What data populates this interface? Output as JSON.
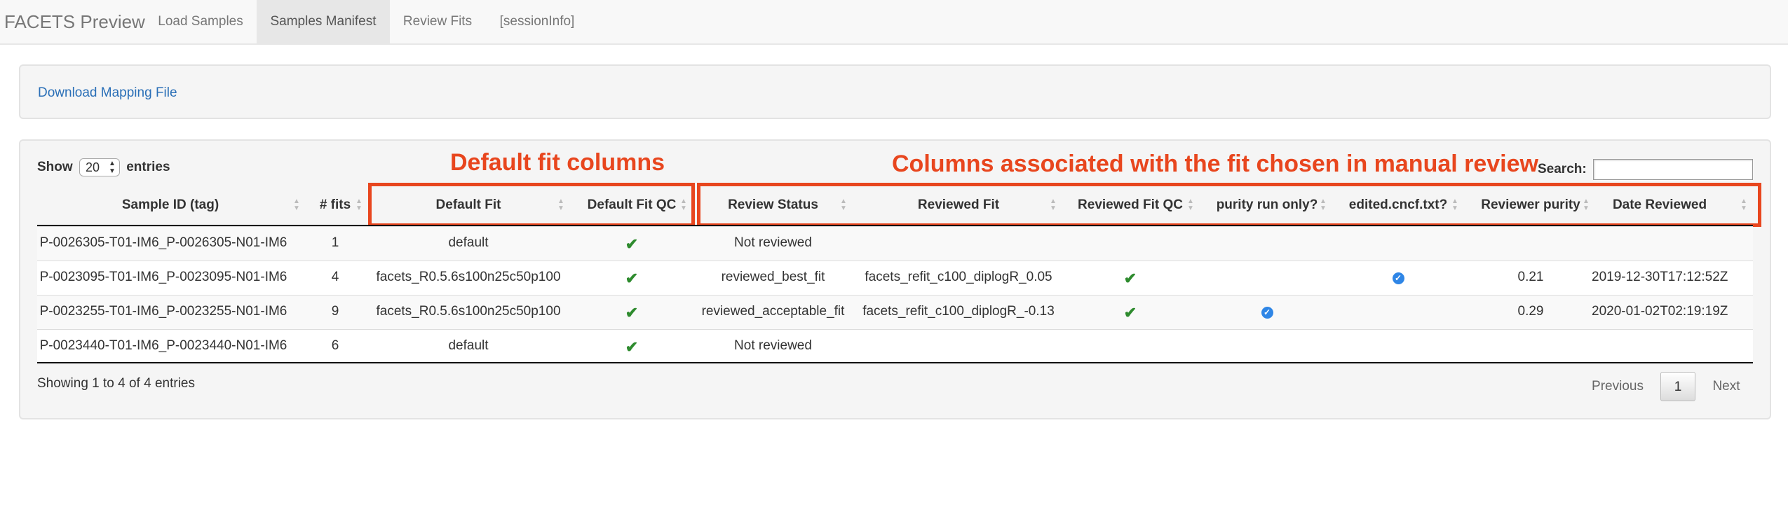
{
  "navbar": {
    "brand": "FACETS Preview",
    "tabs": [
      {
        "label": "Load Samples"
      },
      {
        "label": "Samples Manifest"
      },
      {
        "label": "Review Fits"
      },
      {
        "label": "[sessionInfo]"
      }
    ]
  },
  "download": {
    "label": "Download Mapping File"
  },
  "table_controls": {
    "show_label": "Show",
    "entries_value": "20",
    "entries_label": "entries",
    "search_label": "Search:"
  },
  "annotations": {
    "default_fit": "Default fit columns",
    "manual_review": "Columns associated with the fit chosen in manual review",
    "color": "#e8461e"
  },
  "table": {
    "columns": [
      "Sample ID (tag)",
      "# fits",
      "Default Fit",
      "Default Fit QC",
      "Review Status",
      "Reviewed Fit",
      "Reviewed Fit QC",
      "purity run only?",
      "edited.cncf.txt?",
      "Reviewer purity",
      "Date Reviewed"
    ],
    "rows": [
      {
        "sample_id": "P-0026305-T01-IM6_P-0026305-N01-IM6",
        "fits": "1",
        "default_fit": "default",
        "default_fit_qc": "check",
        "review_status": "Not reviewed",
        "reviewed_fit": "",
        "reviewed_fit_qc": "",
        "purity_run_only": "",
        "edited_cncf": "",
        "reviewer_purity": "",
        "date_reviewed": ""
      },
      {
        "sample_id": "P-0023095-T01-IM6_P-0023095-N01-IM6",
        "fits": "4",
        "default_fit": "facets_R0.5.6s100n25c50p100",
        "default_fit_qc": "check",
        "review_status": "reviewed_best_fit",
        "reviewed_fit": "facets_refit_c100_diplogR_0.05",
        "reviewed_fit_qc": "check",
        "purity_run_only": "",
        "edited_cncf": "badge",
        "reviewer_purity": "0.21",
        "date_reviewed": "2019-12-30T17:12:52Z"
      },
      {
        "sample_id": "P-0023255-T01-IM6_P-0023255-N01-IM6",
        "fits": "9",
        "default_fit": "facets_R0.5.6s100n25c50p100",
        "default_fit_qc": "check",
        "review_status": "reviewed_acceptable_fit",
        "reviewed_fit": "facets_refit_c100_diplogR_-0.13",
        "reviewed_fit_qc": "check",
        "purity_run_only": "badge",
        "edited_cncf": "",
        "reviewer_purity": "0.29",
        "date_reviewed": "2020-01-02T02:19:19Z"
      },
      {
        "sample_id": "P-0023440-T01-IM6_P-0023440-N01-IM6",
        "fits": "6",
        "default_fit": "default",
        "default_fit_qc": "check",
        "review_status": "Not reviewed",
        "reviewed_fit": "",
        "reviewed_fit_qc": "",
        "purity_run_only": "",
        "edited_cncf": "",
        "reviewer_purity": "",
        "date_reviewed": ""
      }
    ]
  },
  "footer": {
    "info": "Showing 1 to 4 of 4 entries",
    "previous": "Previous",
    "page": "1",
    "next": "Next"
  }
}
